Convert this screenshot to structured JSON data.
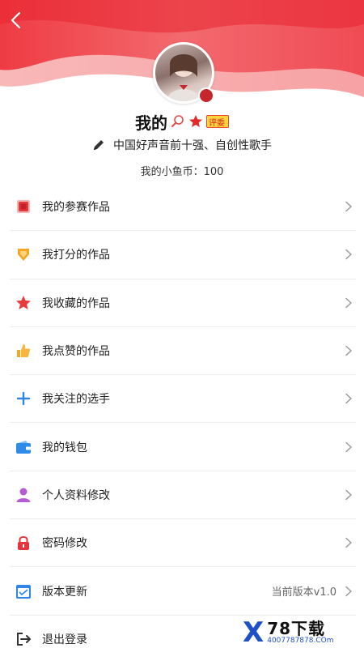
{
  "profile": {
    "name": "我的",
    "badge_label": "评委",
    "bio": "中国好声音前十强、自创性歌手",
    "coins": "我的小鱼币：100"
  },
  "menu": {
    "items": [
      {
        "label": "我的参赛作品",
        "icon": "entries-icon"
      },
      {
        "label": "我打分的作品",
        "icon": "score-icon"
      },
      {
        "label": "我收藏的作品",
        "icon": "star-icon"
      },
      {
        "label": "我点赞的作品",
        "icon": "thumbs-up-icon"
      },
      {
        "label": "我关注的选手",
        "icon": "plus-icon"
      },
      {
        "label": "我的钱包",
        "icon": "wallet-icon"
      },
      {
        "label": "个人资料修改",
        "icon": "person-icon"
      },
      {
        "label": "密码修改",
        "icon": "lock-icon"
      },
      {
        "label": "版本更新",
        "icon": "update-icon",
        "extra": "当前版本v1.0"
      },
      {
        "label": "退出登录",
        "icon": "logout-icon"
      }
    ]
  },
  "watermark": {
    "x": "X",
    "top": "78下载",
    "bottom": "4007787878.COm"
  },
  "colors": {
    "header_red": "#e8323c",
    "header_pink": "#f7a0a0"
  }
}
